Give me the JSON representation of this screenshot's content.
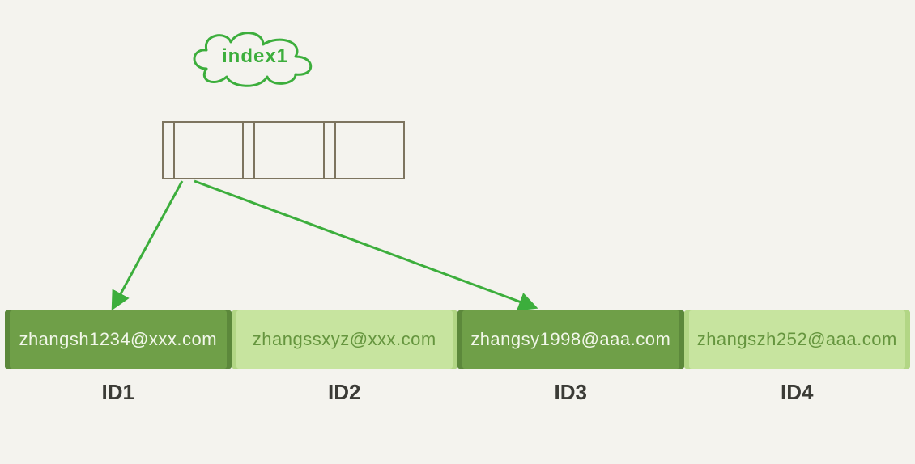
{
  "index": {
    "label": "index1",
    "slot_count": 3
  },
  "pointers": [
    {
      "from_slot": 0,
      "to_cell": 0
    },
    {
      "from_slot": 0,
      "to_cell": 2
    }
  ],
  "cells": [
    {
      "email": "zhangsh1234@xxx.com",
      "id_label": "ID1",
      "shade": "dark"
    },
    {
      "email": "zhangssxyz@xxx.com",
      "id_label": "ID2",
      "shade": "light"
    },
    {
      "email": "zhangsy1998@aaa.com",
      "id_label": "ID3",
      "shade": "dark"
    },
    {
      "email": "zhangszh252@aaa.com",
      "id_label": "ID4",
      "shade": "light"
    }
  ],
  "colors": {
    "accent_green": "#3cae3c",
    "cell_dark": "#6f9f48",
    "cell_light": "#c7e49f"
  }
}
